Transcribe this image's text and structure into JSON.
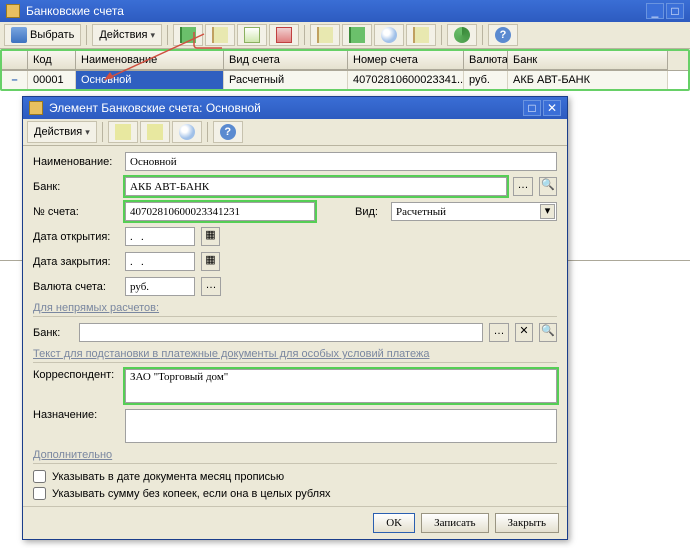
{
  "parent": {
    "title": "Банковские счета",
    "toolbar": {
      "select_label": "Выбрать",
      "actions_label": "Действия"
    },
    "grid": {
      "headers": {
        "code": "Код",
        "name": "Наименование",
        "vid": "Вид счета",
        "acct": "Номер счета",
        "val": "Валюта",
        "bank": "Банк"
      },
      "row": {
        "code": "00001",
        "name": "Основной",
        "vid": "Расчетный",
        "acct": "40702810600023341...",
        "val": "руб.",
        "bank": "АКБ АВТ-БАНК"
      }
    }
  },
  "dialog": {
    "title": "Элемент Банковские счета: Основной",
    "toolbar": {
      "actions_label": "Действия"
    },
    "labels": {
      "name": "Наименование:",
      "bank": "Банк:",
      "acct": "№ счета:",
      "vid": "Вид:",
      "open_date": "Дата открытия:",
      "close_date": "Дата закрытия:",
      "currency": "Валюта счета:",
      "indirect": "Для непрямых расчетов:",
      "bank2": "Банк:",
      "subst": "Текст для подстановки в платежные документы для особых условий платежа",
      "corr": "Корреспондент:",
      "purpose": "Назначение:",
      "addl": "Дополнительно",
      "chk_month": "Указывать в дате документа месяц прописью",
      "chk_kop": "Указывать сумму без копеек, если она в целых рублях"
    },
    "values": {
      "name": "Основной",
      "bank": "АКБ АВТ-БАНК",
      "acct": "40702810600023341231",
      "vid": "Расчетный",
      "open_date": ".   .",
      "close_date": ".   .",
      "currency": "руб.",
      "corr": "ЗАО \"Торговый дом\""
    },
    "buttons": {
      "ok": "OK",
      "write": "Записать",
      "close": "Закрыть"
    }
  }
}
